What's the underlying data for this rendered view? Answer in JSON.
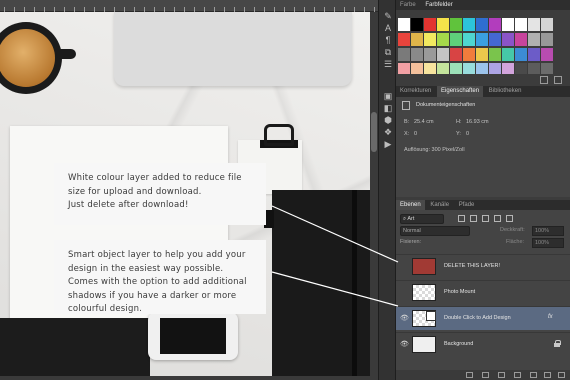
{
  "swatches": {
    "tabs": [
      "Farbe",
      "Farbfelder"
    ],
    "rows": [
      [
        "#ffffff",
        "#000000",
        "#e23430",
        "#f5e34a",
        "#60c33c",
        "#2cc4da",
        "#2f6ed0",
        "#b23dbd",
        "#ffffff",
        "#ffffff",
        "#e4e4e4",
        "#d4d4d4"
      ],
      [
        "#e8443c",
        "#e0b54a",
        "#f2e960",
        "#a5d84a",
        "#5ed07a",
        "#4ed6d0",
        "#3aa0e0",
        "#4468d2",
        "#8a54c8",
        "#c8449c",
        "#b0b0b0",
        "#989898"
      ],
      [
        "#7a7a7a",
        "#8a8a8a",
        "#9a9a9a",
        "#c4c4c4",
        "#d84444",
        "#f07c3c",
        "#ecc84c",
        "#7ac44c",
        "#46c8a8",
        "#3c8cd4",
        "#6c5cc8",
        "#b84cb0"
      ],
      [
        "#f2a0a4",
        "#f4c09c",
        "#f7e49e",
        "#c4e49c",
        "#9ce0b8",
        "#98dcdc",
        "#9cc4ec",
        "#aca4e4",
        "#d2a4dc",
        "#4a4a4a",
        "#5c5c5c",
        "#6c6c6c"
      ]
    ]
  },
  "tools": [
    "✎",
    "A",
    "¶",
    "⧉",
    "☰",
    "▣",
    "◧",
    "⬢",
    "❖",
    "▶"
  ],
  "properties": {
    "tabs": [
      "Korrekturen",
      "Eigenschaften",
      "Bibliotheken"
    ],
    "section_title": "Dokumenteigenschaften",
    "width_label": "B:",
    "width_value": "25.4 cm",
    "height_label": "H:",
    "height_value": "16.93 cm",
    "x_label": "X:",
    "x_value": "0",
    "y_label": "Y:",
    "y_value": "0",
    "resolution": "Auflösung: 300 Pixel/Zoll"
  },
  "layers_panel": {
    "tabs": [
      "Ebenen",
      "Kanäle",
      "Pfade"
    ],
    "filter_kind": "Art",
    "blend_mode": "Normal",
    "opacity_label": "Deckkraft:",
    "opacity_value": "100%",
    "lock_label": "Fixieren:",
    "fill_label": "Fläche:",
    "fill_value": "100%",
    "layers": [
      {
        "name": "DELETE THIS LAYER!",
        "visible": false,
        "selected": false,
        "thumb": "red",
        "fx": "",
        "locked": false
      },
      {
        "name": "Photo Mount",
        "visible": false,
        "selected": false,
        "thumb": "checker",
        "fx": "",
        "locked": false
      },
      {
        "name": "Double Click to Add Design",
        "visible": true,
        "selected": true,
        "thumb": "checker",
        "fx": "fx",
        "locked": false
      },
      {
        "name": "Background",
        "visible": true,
        "selected": false,
        "thumb": "bg",
        "fx": "",
        "locked": true
      }
    ]
  },
  "canvas": {
    "note1": "White colour layer added to reduce file size for upload and download.\nJust delete after download!",
    "note2": "Smart object layer to help you add your design in the easiest way possible. Comes with the option to add additional shadows if you have a darker or more colourful design."
  }
}
